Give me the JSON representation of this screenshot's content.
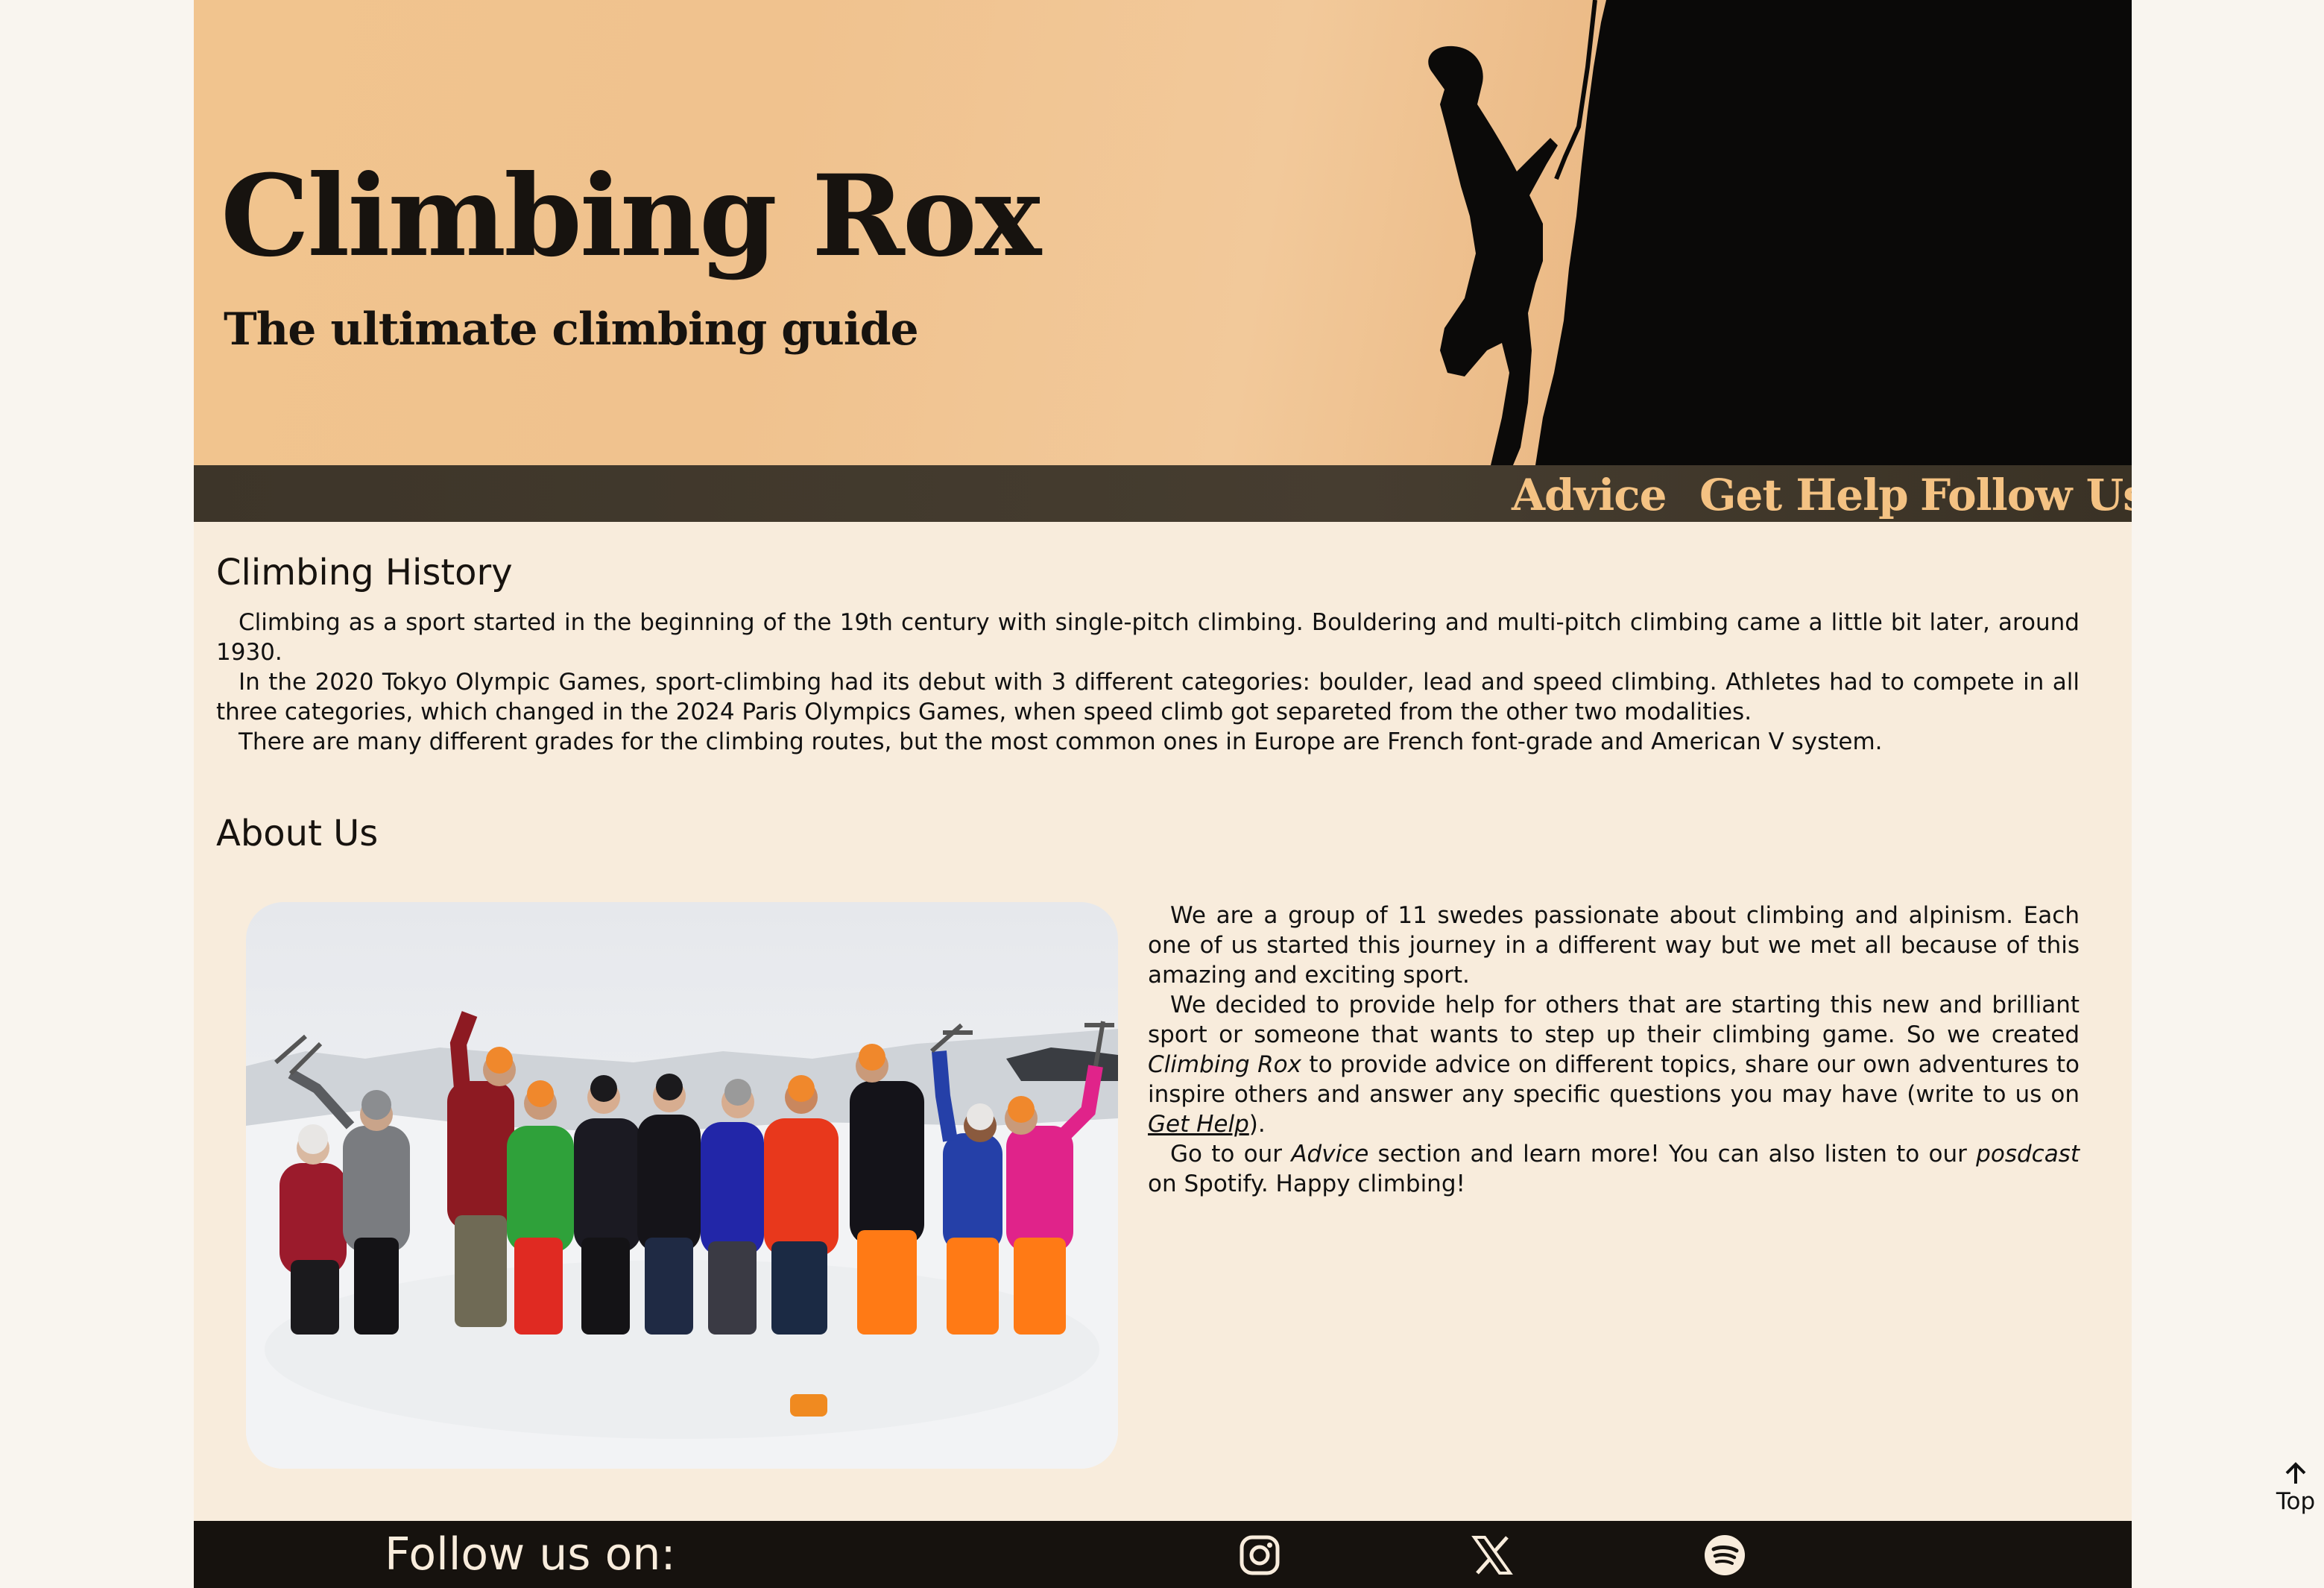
{
  "site": {
    "title": "Climbing Rox",
    "subtitle": "The ultimate climbing guide"
  },
  "nav": {
    "items": [
      {
        "label": "Advice"
      },
      {
        "label": "Get Help"
      },
      {
        "label": "Follow Us"
      }
    ]
  },
  "history": {
    "heading": "Climbing History",
    "paragraphs": [
      "Climbing as a sport started in the beginning of the 19th century with single-pitch climbing. Bouldering and multi-pitch climbing came a little bit later, around 1930.",
      "In the 2020 Tokyo Olympic Games, sport-climbing had its debut with 3 different categories: boulder, lead and speed climbing. Athletes had to compete in all three categories, which changed in the 2024 Paris Olympics Games, when speed climb got separeted from the other two modalities.",
      "There are many different grades for the climbing routes, but the most common ones in Europe are French font-grade and American V system."
    ]
  },
  "about": {
    "heading": "About Us",
    "p1": "We are a group of 11 swedes passionate about climbing and alpinism. Each one of us started this journey in a different way but we met all because of this amazing and exciting sport.",
    "p2_a": "We decided to provide help for others that are starting this new and brilliant sport or someone that wants to step up their climbing game. So we created ",
    "p2_em": "Climbing Rox",
    "p2_b": " to provide advice on different topics, share our own adventures to inspire others and answer any specific questions you may have (write to us on ",
    "p2_link": "Get Help",
    "p2_c": ").",
    "p3_a": "Go to our ",
    "p3_em1": "Advice",
    "p3_b": " section and learn more! You can also listen to our ",
    "p3_em2": "posdcast",
    "p3_c": " on Spotify. Happy climbing!"
  },
  "footer": {
    "label": "Follow us on:",
    "icons": [
      "instagram-icon",
      "x-icon",
      "spotify-icon"
    ]
  },
  "back_to_top": {
    "label": "Top"
  },
  "colors": {
    "background": "#f8ecdc",
    "nav_text": "#f4c283",
    "footer_bg": "#16120e"
  }
}
